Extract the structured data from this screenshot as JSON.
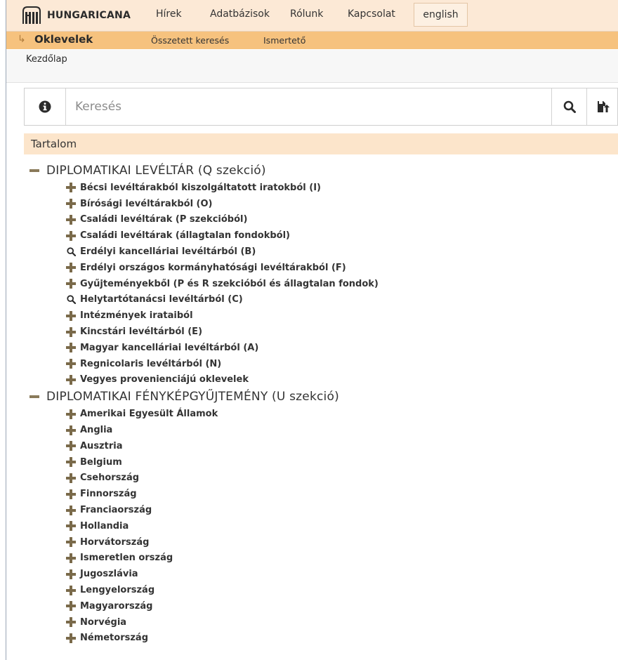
{
  "header": {
    "logo_text": "HUNGARICANA",
    "nav": [
      "Hírek",
      "Adatbázisok",
      "Rólunk",
      "Kapcsolat"
    ],
    "language": "english"
  },
  "subheader": {
    "title": "Oklevelek",
    "links": [
      "Összetett keresés",
      "Ismertető"
    ]
  },
  "breadcrumb": "Kezdőlap",
  "search": {
    "placeholder": "Keresés",
    "value": ""
  },
  "content": {
    "heading": "Tartalom",
    "sections": [
      {
        "title": "DIPLOMATIKAI LEVÉLTÁR (Q szekció)",
        "items": [
          {
            "label": "Bécsi levéltárakból kiszolgáltatott iratokból (I)",
            "icon": "plus"
          },
          {
            "label": "Bírósági levéltárakból (O)",
            "icon": "plus"
          },
          {
            "label": "Családi levéltárak (P szekcióból)",
            "icon": "plus"
          },
          {
            "label": "Családi levéltárak (állagtalan fondokból)",
            "icon": "plus"
          },
          {
            "label": "Erdélyi kancelláriai levéltárból (B)",
            "icon": "search"
          },
          {
            "label": "Erdélyi országos kormányhatósági levéltárakból (F)",
            "icon": "plus"
          },
          {
            "label": "Gyűjteményekből (P és R szekcióból és állagtalan fondok)",
            "icon": "plus"
          },
          {
            "label": "Helytartótanácsi levéltárból (C)",
            "icon": "search"
          },
          {
            "label": "Intézmények irataiból",
            "icon": "plus"
          },
          {
            "label": "Kincstári levéltárból (E)",
            "icon": "plus"
          },
          {
            "label": "Magyar kancelláriai levéltárból (A)",
            "icon": "plus"
          },
          {
            "label": "Regnicolaris levéltárból (N)",
            "icon": "plus"
          },
          {
            "label": "Vegyes provenienciájú oklevelek",
            "icon": "plus"
          }
        ]
      },
      {
        "title": "DIPLOMATIKAI FÉNYKÉPGYŰJTEMÉNY (U szekció)",
        "items": [
          {
            "label": "Amerikai Egyesült Államok",
            "icon": "plus"
          },
          {
            "label": "Anglia",
            "icon": "plus"
          },
          {
            "label": "Ausztria",
            "icon": "plus"
          },
          {
            "label": "Belgium",
            "icon": "plus"
          },
          {
            "label": "Csehország",
            "icon": "plus"
          },
          {
            "label": "Finnország",
            "icon": "plus"
          },
          {
            "label": "Franciaország",
            "icon": "plus"
          },
          {
            "label": "Hollandia",
            "icon": "plus"
          },
          {
            "label": "Horvátország",
            "icon": "plus"
          },
          {
            "label": "Ismeretlen ország",
            "icon": "plus"
          },
          {
            "label": "Jugoszlávia",
            "icon": "plus"
          },
          {
            "label": "Lengyelország",
            "icon": "plus"
          },
          {
            "label": "Magyarország",
            "icon": "plus"
          },
          {
            "label": "Norvégia",
            "icon": "plus"
          },
          {
            "label": "Németország",
            "icon": "plus"
          }
        ]
      }
    ]
  },
  "colors": {
    "topbar_bg": "#fce9d6",
    "subbar_bg": "#f6c27e",
    "content_head_bg": "#fce5cb",
    "icon_color": "#7a6a4a"
  }
}
